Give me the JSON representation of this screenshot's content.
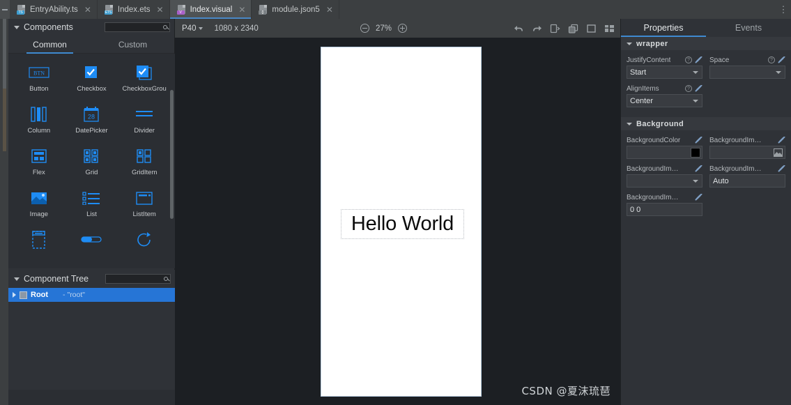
{
  "window": {
    "tabs": [
      {
        "label": "EntryAbility.ts",
        "badge": "TS",
        "badge_kind": "ts",
        "active": false
      },
      {
        "label": "Index.ets",
        "badge": "ETS",
        "badge_kind": "ets",
        "active": false
      },
      {
        "label": "Index.visual",
        "badge": "V",
        "badge_kind": "vis",
        "active": true
      },
      {
        "label": "module.json5",
        "badge": "{}",
        "badge_kind": "json",
        "active": false
      }
    ],
    "more_icon": "⋮",
    "close_glyph": "✕"
  },
  "left_panel": {
    "components": {
      "title": "Components",
      "search_placeholder": "",
      "search_icon": "search-icon",
      "tabs": [
        {
          "label": "Common",
          "active": true
        },
        {
          "label": "Custom",
          "active": false
        }
      ],
      "items": [
        {
          "label": "Button",
          "icon": "button-icon"
        },
        {
          "label": "Checkbox",
          "icon": "checkbox-icon"
        },
        {
          "label": "CheckboxGrou",
          "icon": "checkbox-group-icon"
        },
        {
          "label": "Column",
          "icon": "column-icon"
        },
        {
          "label": "DatePicker",
          "icon": "datepicker-icon"
        },
        {
          "label": "Divider",
          "icon": "divider-icon"
        },
        {
          "label": "Flex",
          "icon": "flex-icon"
        },
        {
          "label": "Grid",
          "icon": "grid-icon"
        },
        {
          "label": "GridItem",
          "icon": "griditem-icon"
        },
        {
          "label": "Image",
          "icon": "image-icon"
        },
        {
          "label": "List",
          "icon": "list-icon"
        },
        {
          "label": "ListItem",
          "icon": "listitem-icon"
        },
        {
          "label": "",
          "icon": "navigator-icon"
        },
        {
          "label": "",
          "icon": "progress-icon"
        },
        {
          "label": "",
          "icon": "loading-icon"
        }
      ],
      "button_icon_text": "BTN",
      "datepicker_day": "28"
    },
    "component_tree": {
      "title": "Component Tree",
      "search_icon": "search-icon",
      "rows": [
        {
          "label": "Root",
          "sub": "- \"root\"",
          "selected": true
        }
      ]
    }
  },
  "toolbar": {
    "device": "P40",
    "resolution": "1080 x 2340",
    "zoom": "27%",
    "zoom_out_icon": "minus-circle-icon",
    "zoom_in_icon": "plus-circle-icon",
    "actions": [
      {
        "name": "undo-icon"
      },
      {
        "name": "redo-icon"
      },
      {
        "name": "device-preview-icon"
      },
      {
        "name": "layers-icon"
      },
      {
        "name": "frame-icon"
      },
      {
        "name": "layout-icon"
      }
    ]
  },
  "canvas": {
    "preview_text": "Hello World",
    "watermark": "CSDN @夏沫琉琶"
  },
  "right_panel": {
    "tabs": [
      {
        "label": "Properties",
        "active": true
      },
      {
        "label": "Events",
        "active": false
      }
    ],
    "sections": [
      {
        "title": "wrapper",
        "fields": [
          {
            "label": "JustifyContent",
            "value": "Start",
            "type": "select",
            "help": true,
            "link": true
          },
          {
            "label": "Space",
            "value": "",
            "type": "select",
            "help": true,
            "link": true
          },
          {
            "label": "AlignItems",
            "value": "Center",
            "type": "select",
            "help": true,
            "link": true
          }
        ]
      },
      {
        "title": "Background",
        "fields": [
          {
            "label": "BackgroundColor",
            "value": "",
            "type": "color",
            "color": "#000000",
            "help": false,
            "link": true
          },
          {
            "label": "BackgroundIma...",
            "value": "",
            "type": "image",
            "help": false,
            "link": true
          },
          {
            "label": "BackgroundIma...",
            "value": "",
            "type": "select",
            "help": false,
            "link": true
          },
          {
            "label": "BackgroundIma...",
            "value": "Auto",
            "type": "text",
            "help": false,
            "link": true
          },
          {
            "label": "BackgroundIma...",
            "value": "0 0",
            "type": "text",
            "help": false,
            "link": true
          }
        ]
      }
    ],
    "help_glyph": "?",
    "colors": {
      "accent": "#3f8ad1",
      "panel_bg": "#2f3237",
      "section_bg": "#36393e"
    }
  }
}
